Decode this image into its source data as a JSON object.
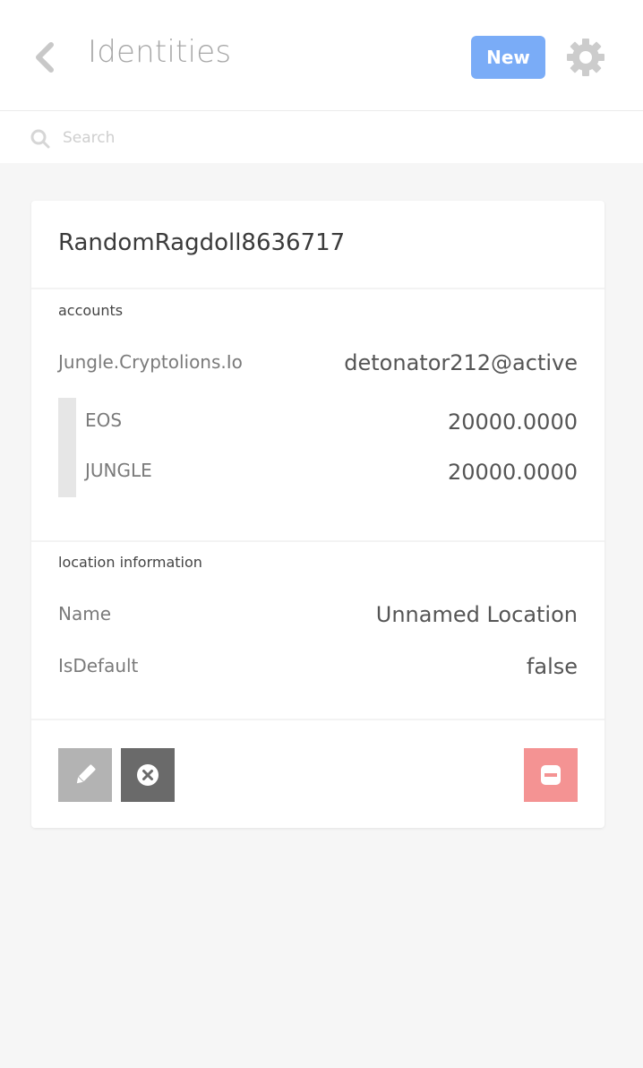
{
  "header": {
    "title": "Identities",
    "new_label": "New",
    "back_icon": "chevron-left-icon",
    "settings_icon": "gear-icon"
  },
  "search": {
    "placeholder": "Search",
    "value": ""
  },
  "identity": {
    "name": "RandomRagdoll8636717",
    "accounts_label": "accounts",
    "account": {
      "network": "Jungle.Cryptolions.Io",
      "name": "detonator212@active",
      "balances": [
        {
          "token": "EOS",
          "amount": "20000.0000"
        },
        {
          "token": "JUNGLE",
          "amount": "20000.0000"
        }
      ]
    },
    "location_label": "location information",
    "location": [
      {
        "label": "Name",
        "value": "Unnamed Location"
      },
      {
        "label": "IsDefault",
        "value": "false"
      }
    ]
  },
  "actions": {
    "edit_icon": "pencil-icon",
    "close_icon": "close-circle-icon",
    "remove_icon": "minus-icon"
  },
  "colors": {
    "accent": "#7aacf7",
    "danger": "#f49393",
    "close": "#6a6a6a",
    "edit": "#b3b3b3"
  }
}
